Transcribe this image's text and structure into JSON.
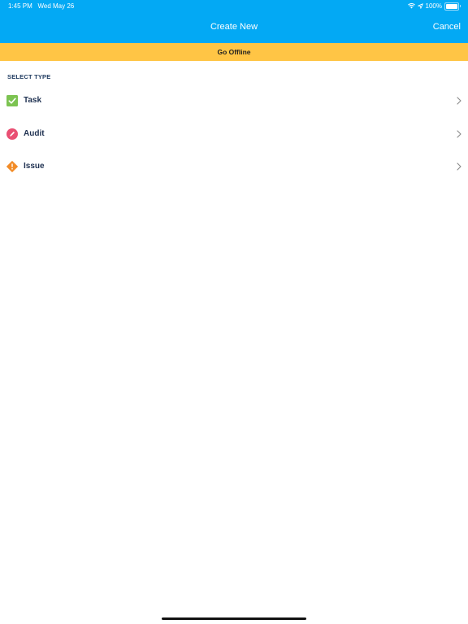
{
  "status_bar": {
    "time": "1:45 PM",
    "date": "Wed May 26",
    "battery": "100%"
  },
  "nav": {
    "title": "Create New",
    "cancel_label": "Cancel"
  },
  "offline_banner": {
    "label": "Go Offline"
  },
  "section": {
    "header": "SELECT TYPE",
    "items": [
      {
        "label": "Task",
        "icon": "checkmark-icon",
        "color": "#7cc351"
      },
      {
        "label": "Audit",
        "icon": "pencil-icon",
        "color": "#e94f73"
      },
      {
        "label": "Issue",
        "icon": "warning-icon",
        "color": "#f28c28"
      }
    ]
  },
  "colors": {
    "nav_bar": "#03a9f4",
    "offline_banner": "#ffc545",
    "section_text": "#1e3a5f"
  }
}
